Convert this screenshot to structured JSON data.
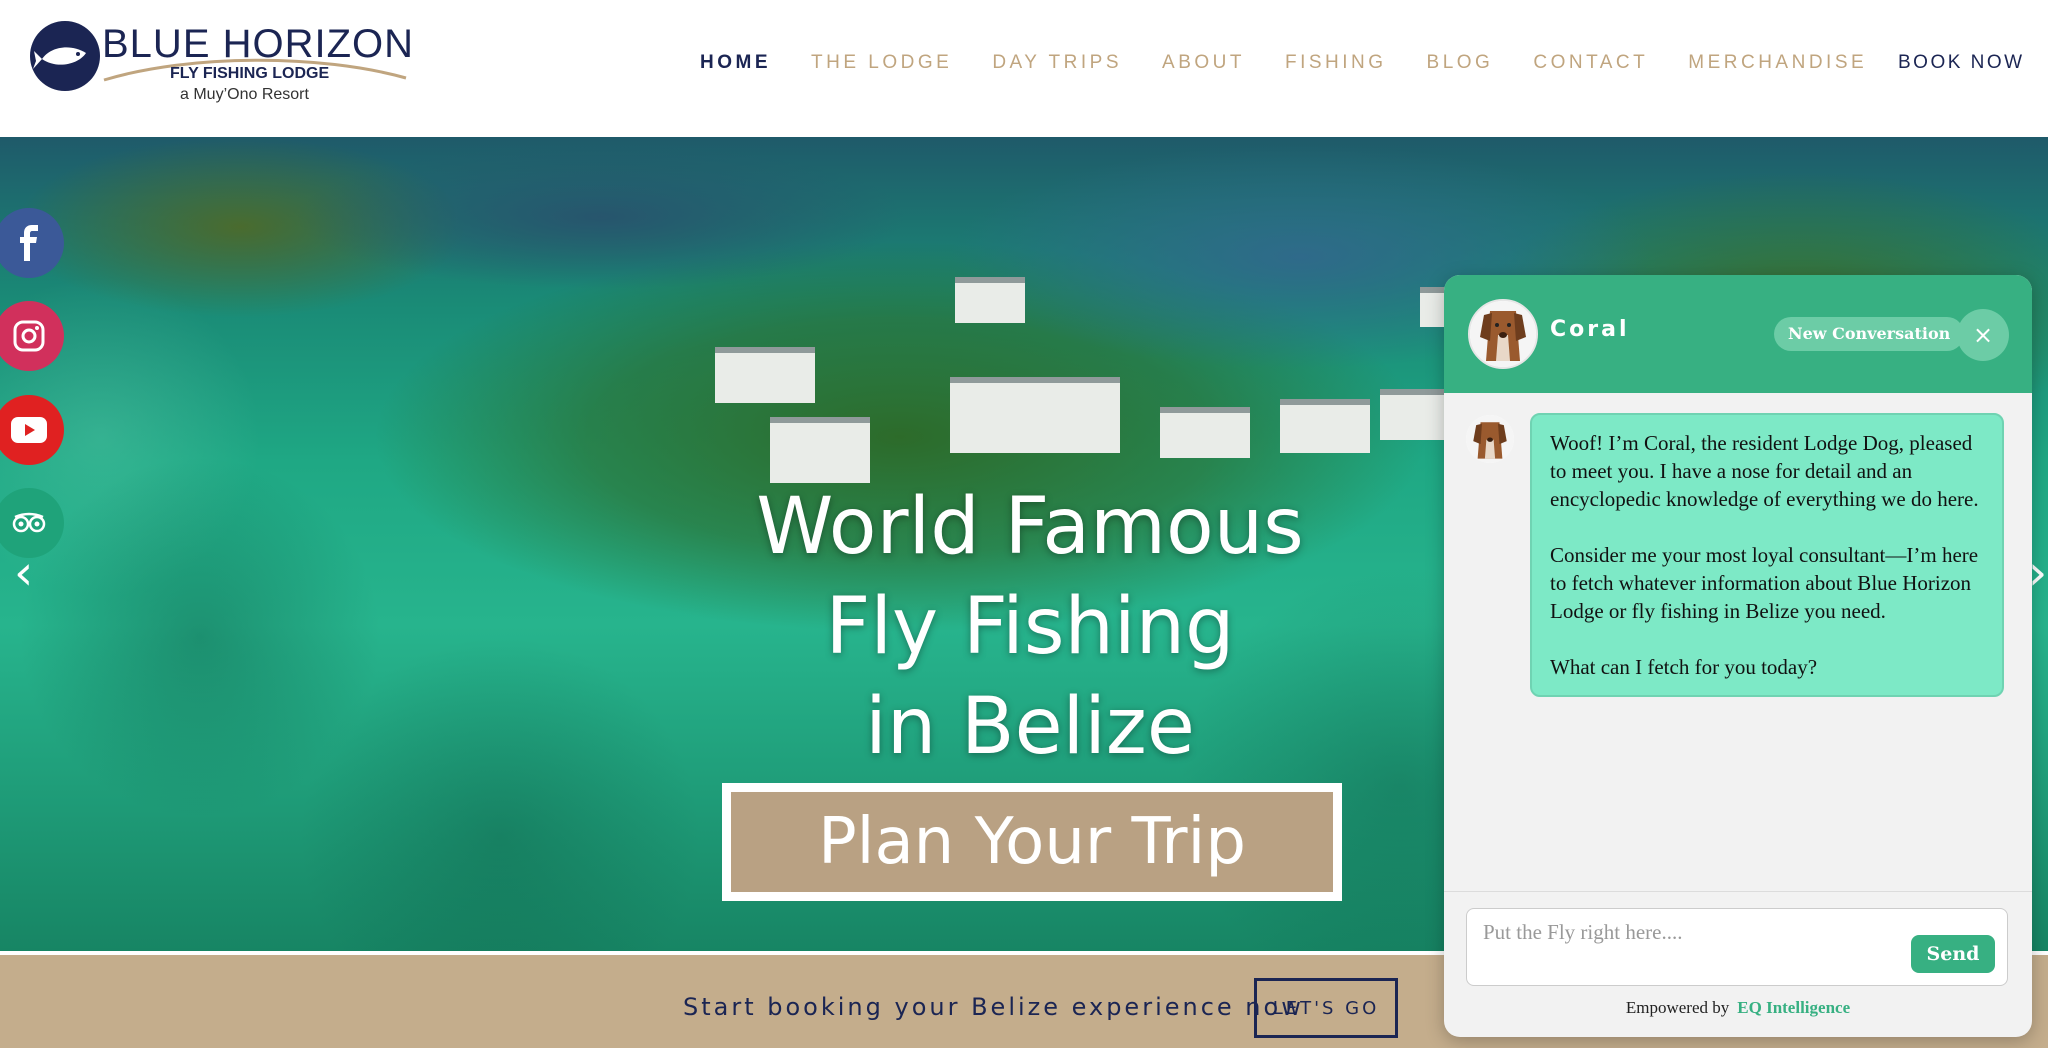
{
  "brand": {
    "title": "BLUE HORIZON",
    "subtitle": "FLY FISHING LODGE",
    "tagline": "a Muy’Ono Resort"
  },
  "nav": {
    "items": [
      "HOME",
      "THE LODGE",
      "DAY TRIPS",
      "ABOUT",
      "FISHING",
      "BLOG",
      "CONTACT",
      "MERCHANDISE"
    ],
    "active": "HOME",
    "book_now": "BOOK NOW"
  },
  "hero": {
    "title_line1": "World Famous",
    "title_line2": "Fly Fishing",
    "title_line3": "in Belize",
    "cta": "Plan Your Trip",
    "prev_arrow": "‹",
    "next_arrow": "›"
  },
  "social": [
    {
      "name": "facebook-icon",
      "color": "#3b5998"
    },
    {
      "name": "instagram-icon",
      "color": "#d1305c"
    },
    {
      "name": "youtube-icon",
      "color": "#e02121"
    },
    {
      "name": "tripadvisor-icon",
      "color": "#1fa37a"
    }
  ],
  "booking": {
    "text": "Start booking your Belize experience now",
    "button": "LET'S GO"
  },
  "chat": {
    "name": "Coral",
    "new_conversation": "New Conversation",
    "close": "×",
    "message": {
      "p1": "Woof! I’m Coral, the resident Lodge Dog, pleased to meet you. I have a nose for detail and an encyclopedic knowledge of everything we do here.",
      "p2": "Consider me your most loyal consultant—I’m here to fetch whatever information about Blue Horizon Lodge or fly fishing in Belize you need.",
      "p3": "What can I fetch for you today?"
    },
    "input_placeholder": "Put the Fly right here....",
    "send": "Send",
    "powered_prefix": "Empowered by",
    "powered_brand": "EQ Intelligence"
  },
  "colors": {
    "navy": "#1b2553",
    "gold": "#c0a57f",
    "chat_green": "#37b082",
    "bubble_green": "#7de9c6",
    "sand": "#c4ad8c"
  }
}
